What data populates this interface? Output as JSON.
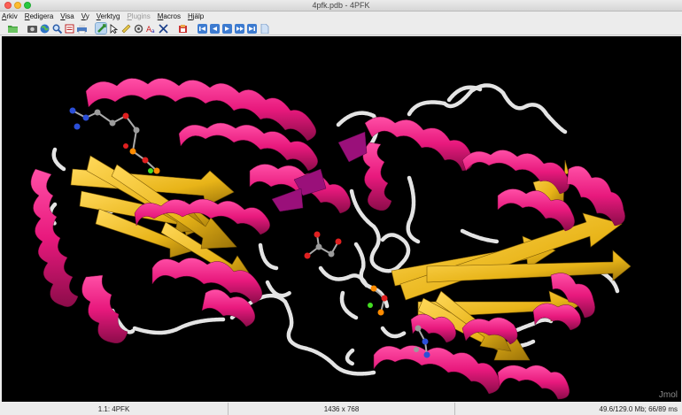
{
  "window": {
    "title": "4pfk.pdb - 4PFK"
  },
  "menu": [
    {
      "label": "Arkiv",
      "enabled": true
    },
    {
      "label": "Redigera",
      "enabled": true
    },
    {
      "label": "Visa",
      "enabled": true
    },
    {
      "label": "Vy",
      "enabled": true
    },
    {
      "label": "Verktyg",
      "enabled": true
    },
    {
      "label": "Plugins",
      "enabled": false
    },
    {
      "label": "Macros",
      "enabled": true
    },
    {
      "label": "Hjälp",
      "enabled": true
    }
  ],
  "toolbar": [
    "open-folder-icon",
    "camera-icon",
    "globe-icon",
    "magnifier-icon",
    "script-icon",
    "print-icon",
    "rotate-icon",
    "cursor-icon",
    "ruler-icon",
    "spin-icon",
    "font-icon",
    "crosshair-icon",
    "clipboard-icon",
    "first-frame-icon",
    "prev-frame-icon",
    "play-icon",
    "next-frame-icon",
    "last-frame-icon"
  ],
  "colors": {
    "helix": "#e8197d",
    "sheet": "#e8b418",
    "coil": "#e4e4e4",
    "turn": "#9a107a"
  },
  "viewer": {
    "watermark": "Jmol"
  },
  "status": {
    "model": "1.1: 4PFK",
    "size": "1436 x 768",
    "memory": "49.6/129.0 Mb;  66/89 ms"
  }
}
